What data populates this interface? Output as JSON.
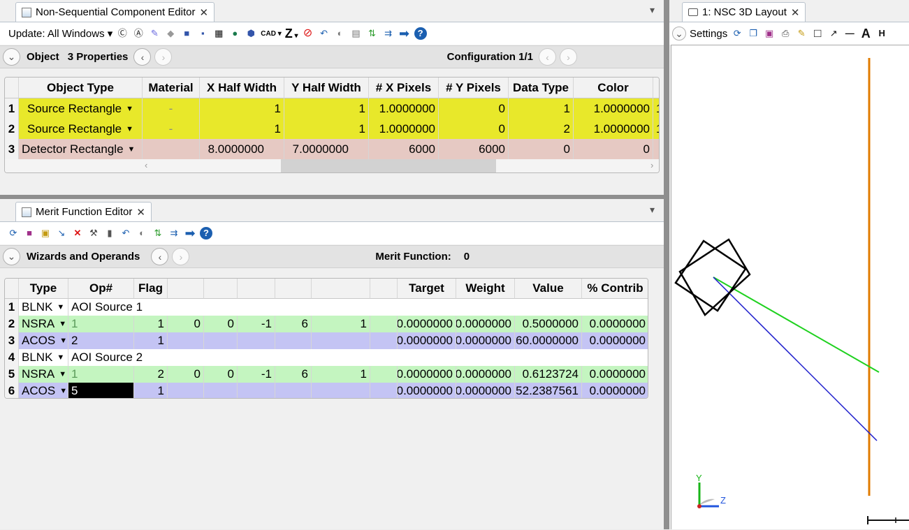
{
  "nsce": {
    "tab_title": "Non-Sequential Component Editor",
    "update_label": "Update: All Windows",
    "cad_label": "CAD",
    "z_label": "Z",
    "bar": {
      "section_label": "Object",
      "properties_label": "3 Properties",
      "config_label": "Configuration 1/1"
    },
    "columns": [
      "Object Type",
      "Material",
      "X Half Width",
      "Y Half Width",
      "# X Pixels",
      "# Y Pixels",
      "Data Type",
      "Color"
    ],
    "rows": [
      {
        "num": "1",
        "type": "Source Rectangle",
        "material": "-",
        "c3": "1",
        "c4": "1",
        "c5": "1.0000000",
        "c6": "0",
        "c7": "1",
        "c8": "1.0000000",
        "c9": "1"
      },
      {
        "num": "2",
        "type": "Source Rectangle",
        "material": "-",
        "c3": "1",
        "c4": "1",
        "c5": "1.0000000",
        "c6": "0",
        "c7": "2",
        "c8": "1.0000000",
        "c9": "1"
      },
      {
        "num": "3",
        "type": "Detector Rectangle",
        "material": "",
        "c3": "8.0000000",
        "c4": "7.0000000",
        "c5": "6000",
        "c6": "6000",
        "c7": "0",
        "c8": "0",
        "c9": ""
      }
    ],
    "row_colors": [
      "#e8e82a",
      "#e8e82a",
      "#e6c9c3"
    ]
  },
  "mfe": {
    "tab_title": "Merit Function Editor",
    "bar": {
      "section_label": "Wizards and Operands",
      "merit_label": "Merit Function:",
      "merit_value": "0"
    },
    "columns": [
      "Type",
      "Op#",
      "Flag",
      "",
      "",
      "",
      "",
      "",
      "Target",
      "Weight",
      "Value",
      "% Contrib"
    ],
    "rows": [
      {
        "num": "1",
        "type": "BLNK",
        "comment": "AOI Source 1"
      },
      {
        "num": "2",
        "type": "NSRA",
        "op": "1",
        "flag": "1",
        "p1": "0",
        "p2": "0",
        "p3": "-1",
        "p4": "6",
        "p5": "1",
        "target": "0.0000000",
        "weight": "0.0000000",
        "value": "0.5000000",
        "contrib": "0.0000000"
      },
      {
        "num": "3",
        "type": "ACOS",
        "op": "2",
        "flag": "1",
        "target": "0.0000000",
        "weight": "0.0000000",
        "value": "60.0000000",
        "contrib": "0.0000000"
      },
      {
        "num": "4",
        "type": "BLNK",
        "comment": "AOI Source 2"
      },
      {
        "num": "5",
        "type": "NSRA",
        "op": "1",
        "flag": "2",
        "p1": "0",
        "p2": "0",
        "p3": "-1",
        "p4": "6",
        "p5": "1",
        "target": "0.0000000",
        "weight": "0.0000000",
        "value": "0.6123724",
        "contrib": "0.0000000"
      },
      {
        "num": "6",
        "type": "ACOS",
        "op": "5",
        "flag": "1",
        "target": "0.0000000",
        "weight": "0.0000000",
        "value": "52.2387561",
        "contrib": "0.0000000"
      }
    ]
  },
  "layout": {
    "tab_title": "1: NSC 3D Layout",
    "settings_label": "Settings",
    "axis_y": "Y",
    "axis_z": "Z",
    "colors": {
      "detector": "#e07b00",
      "ray1": "#1fd11f",
      "ray2": "#1a1acc",
      "source": "#000000"
    }
  },
  "icons": {
    "close": "close-icon",
    "chevron": "chevron-down-icon",
    "prev": "chevron-left-icon",
    "next": "chevron-right-icon",
    "help": "help-icon",
    "menu": "menu-icon"
  }
}
